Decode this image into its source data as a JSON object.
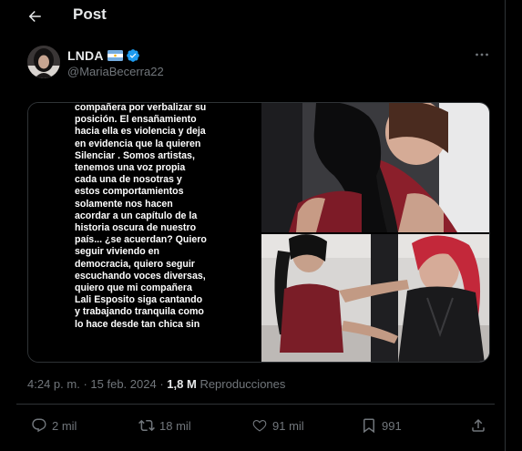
{
  "header": {
    "title": "Post",
    "back_icon": "arrow-left-icon"
  },
  "author": {
    "display_name": "LNDA",
    "handle": "@MariaBecerra22",
    "flag_icon": "argentina-flag-icon",
    "verified_icon": "verified-badge-icon",
    "verified_color": "#1d9bf0",
    "more_icon": "more-dots-icon"
  },
  "media": {
    "statement_lines": [
      "compañera por verbalizar su",
      "posición. El ensañamiento",
      "hacia ella es violencia y deja",
      "en evidencia que la quieren",
      "Silenciar . Somos artistas,",
      "tenemos una voz propia",
      "cada una de nosotras y",
      "estos comportamientos",
      "solamente nos hacen",
      "acordar a un capítulo de la",
      "historia oscura de nuestro",
      "país... ¿se acuerdan? Quiero",
      "seguir viviendo en",
      "democracia, quiero seguir",
      "escuchando voces diversas,",
      "quiero que mi compañera",
      "Lali Esposito siga cantando",
      "y trabajando tranquila como",
      "lo hace desde tan chica sin"
    ]
  },
  "meta": {
    "time": "4:24 p. m.",
    "separator": "·",
    "date": "15 feb. 2024",
    "views_count": "1,8 M",
    "views_label": "Reproducciones"
  },
  "actions": {
    "reply_count": "2 mil",
    "repost_count": "18 mil",
    "like_count": "91 mil",
    "bookmark_count": "991"
  },
  "colors": {
    "background": "#000000",
    "text_primary": "#e7e9ea",
    "text_secondary": "#71767b",
    "border": "#2f3336",
    "accent": "#1d9bf0"
  }
}
